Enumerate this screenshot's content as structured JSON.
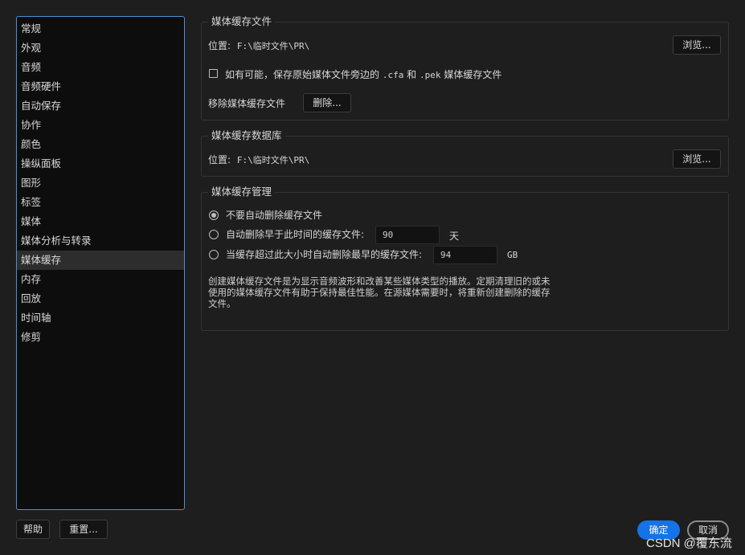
{
  "sidebar": {
    "items": [
      {
        "label": "常规"
      },
      {
        "label": "外观"
      },
      {
        "label": "音频"
      },
      {
        "label": "音频硬件"
      },
      {
        "label": "自动保存"
      },
      {
        "label": "协作"
      },
      {
        "label": "颜色"
      },
      {
        "label": "操纵面板"
      },
      {
        "label": "图形"
      },
      {
        "label": "标签"
      },
      {
        "label": "媒体"
      },
      {
        "label": "媒体分析与转录"
      },
      {
        "label": "媒体缓存"
      },
      {
        "label": "内存"
      },
      {
        "label": "回放"
      },
      {
        "label": "时间轴"
      },
      {
        "label": "修剪"
      }
    ],
    "selected": "媒体缓存"
  },
  "media_cache_files": {
    "title": "媒体缓存文件",
    "location_label": "位置:",
    "location_value": "F:\\临时文件\\PR\\",
    "browse_label": "浏览...",
    "checkbox_label_1": "如有可能，保存原始媒体文件旁边的",
    "checkbox_ext_1": ".cfa",
    "checkbox_and": "和",
    "checkbox_ext_2": ".pek",
    "checkbox_label_2": "媒体缓存文件",
    "checkbox_checked": false,
    "remove_label": "移除媒体缓存文件",
    "delete_label": "删除..."
  },
  "media_cache_db": {
    "title": "媒体缓存数据库",
    "location_label": "位置:",
    "location_value": "F:\\临时文件\\PR\\",
    "browse_label": "浏览..."
  },
  "media_cache_mgmt": {
    "title": "媒体缓存管理",
    "option_1": "不要自动删除缓存文件",
    "option_2": "自动删除早于此时间的缓存文件:",
    "option_2_value": "90",
    "option_2_unit": "天",
    "option_3": "当缓存超过此大小时自动删除最早的缓存文件:",
    "option_3_value": "94",
    "option_3_unit": "GB",
    "selected_option": 1,
    "description": "创建媒体缓存文件是为显示音频波形和改善某些媒体类型的播放。定期清理旧的或未使用的媒体缓存文件有助于保持最佳性能。在源媒体需要时，将重新创建删除的缓存文件。"
  },
  "footer": {
    "help_label": "帮助",
    "reset_label": "重置...",
    "ok_label": "确定",
    "cancel_label": "取消"
  },
  "watermark": "CSDN @覆东流",
  "colors": {
    "accent": "#1473e6",
    "sidebar_border": "#4a90d9",
    "background": "#1e1e1e"
  }
}
